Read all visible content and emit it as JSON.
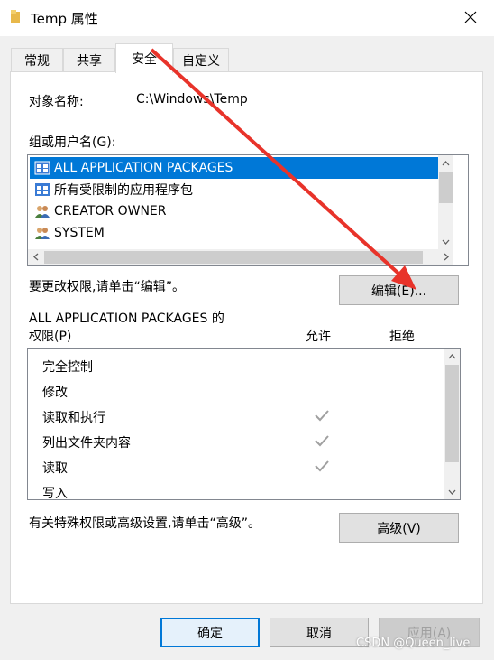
{
  "window": {
    "title": "Temp 属性",
    "close_glyph": "✕"
  },
  "tabs": [
    {
      "label": "常规"
    },
    {
      "label": "共享"
    },
    {
      "label": "安全",
      "active": true
    },
    {
      "label": "自定义"
    }
  ],
  "security": {
    "object_label": "对象名称:",
    "object_value": "C:\\Windows\\Temp",
    "groups_label": "组或用户名(G):",
    "groups": [
      {
        "name": "ALL APPLICATION PACKAGES",
        "icon": "app-packages-icon",
        "selected": true
      },
      {
        "name": "所有受限制的应用程序包",
        "icon": "app-packages-icon",
        "selected": false
      },
      {
        "name": "CREATOR OWNER",
        "icon": "users-group-icon",
        "selected": false
      },
      {
        "name": "SYSTEM",
        "icon": "users-group-icon",
        "selected": false
      }
    ],
    "edit_hint": "要更改权限,请单击“编辑”。",
    "edit_button": "编辑(E)...",
    "perm_title_line1": "ALL APPLICATION PACKAGES 的",
    "perm_title_line2": "权限(P)",
    "col_allow": "允许",
    "col_deny": "拒绝",
    "permissions": [
      {
        "name": "完全控制",
        "allow": false,
        "deny": false
      },
      {
        "name": "修改",
        "allow": false,
        "deny": false
      },
      {
        "name": "读取和执行",
        "allow": true,
        "deny": false
      },
      {
        "name": "列出文件夹内容",
        "allow": true,
        "deny": false
      },
      {
        "name": "读取",
        "allow": true,
        "deny": false
      },
      {
        "name": "写入",
        "allow": false,
        "deny": false
      }
    ],
    "advanced_hint": "有关特殊权限或高级设置,请单击“高级”。",
    "advanced_button": "高级(V)"
  },
  "footer": {
    "ok": "确定",
    "cancel": "取消",
    "apply": "应用(A)"
  },
  "watermark": "CSDN @Queen_live",
  "colors": {
    "selection": "#0078d7",
    "arrow": "#e8332a",
    "check": "#a0a0a0"
  }
}
